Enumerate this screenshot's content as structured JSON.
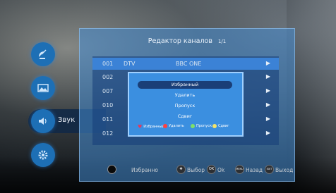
{
  "panel": {
    "title": "Редактор каналов",
    "page": "1/1"
  },
  "side_menu": {
    "sound_label": "Звук",
    "icons": [
      "satellite-dish-icon",
      "picture-icon",
      "speaker-icon",
      "gear-icon"
    ]
  },
  "channels": [
    {
      "num": "001",
      "type": "DTV",
      "name": "BBC ONE"
    },
    {
      "num": "002",
      "type": "",
      "name": ""
    },
    {
      "num": "007",
      "type": "",
      "name": ""
    },
    {
      "num": "010",
      "type": "",
      "name": ""
    },
    {
      "num": "011",
      "type": "",
      "name": ""
    },
    {
      "num": "012",
      "type": "",
      "name": ""
    }
  ],
  "popup": {
    "options": [
      "Избранный",
      "Удалить",
      "Пропуск",
      "Сдвиг"
    ],
    "legend": [
      {
        "label": "Избранный",
        "color": "#e8365a"
      },
      {
        "label": "Удалить",
        "color": "#ff4040"
      },
      {
        "label": "Пропуск",
        "color": "#7ee06a"
      },
      {
        "label": "Сдвиг",
        "color": "#f4e36a"
      }
    ]
  },
  "bottom_bar": {
    "favorite": "Избранно",
    "select": "Выбор",
    "ok_badge": "OK",
    "ok": "Ok",
    "menu_badge": "MENU",
    "back": "Назад",
    "exit_badge": "EXIT",
    "exit": "Выход"
  },
  "colors": {
    "panel": "#4a8fd4",
    "popup": "#3b8fe0",
    "selected": "#1a3f78"
  }
}
